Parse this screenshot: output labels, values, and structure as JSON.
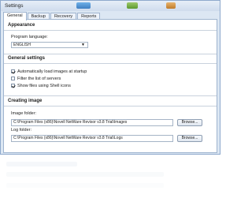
{
  "window": {
    "title": "Settings"
  },
  "tabs": [
    {
      "label": "General",
      "active": true
    },
    {
      "label": "Backup",
      "active": false
    },
    {
      "label": "Recovery",
      "active": false
    },
    {
      "label": "Reports",
      "active": false
    }
  ],
  "appearance": {
    "heading": "Appearance",
    "language_label": "Program language:",
    "language_value": "ENGLISH"
  },
  "general_settings": {
    "heading": "General settings",
    "options": [
      {
        "label": "Automatically load images at startup",
        "checked": true
      },
      {
        "label": "Filter the list of servers",
        "checked": false
      },
      {
        "label": "Show files using Shell icons",
        "checked": true
      }
    ]
  },
  "creating_image": {
    "heading": "Creating image",
    "image_folder_label": "Image folder:",
    "image_folder_value": "C:\\Program Files (x86)\\Novell NetWare Revisor v3.8 Trial\\Images",
    "log_folder_label": "Log folder:",
    "log_folder_value": "C:\\Program Files (x86)\\Novell NetWare Revisor v3.8 Trial\\Logs",
    "browse_label": "Browse..."
  }
}
